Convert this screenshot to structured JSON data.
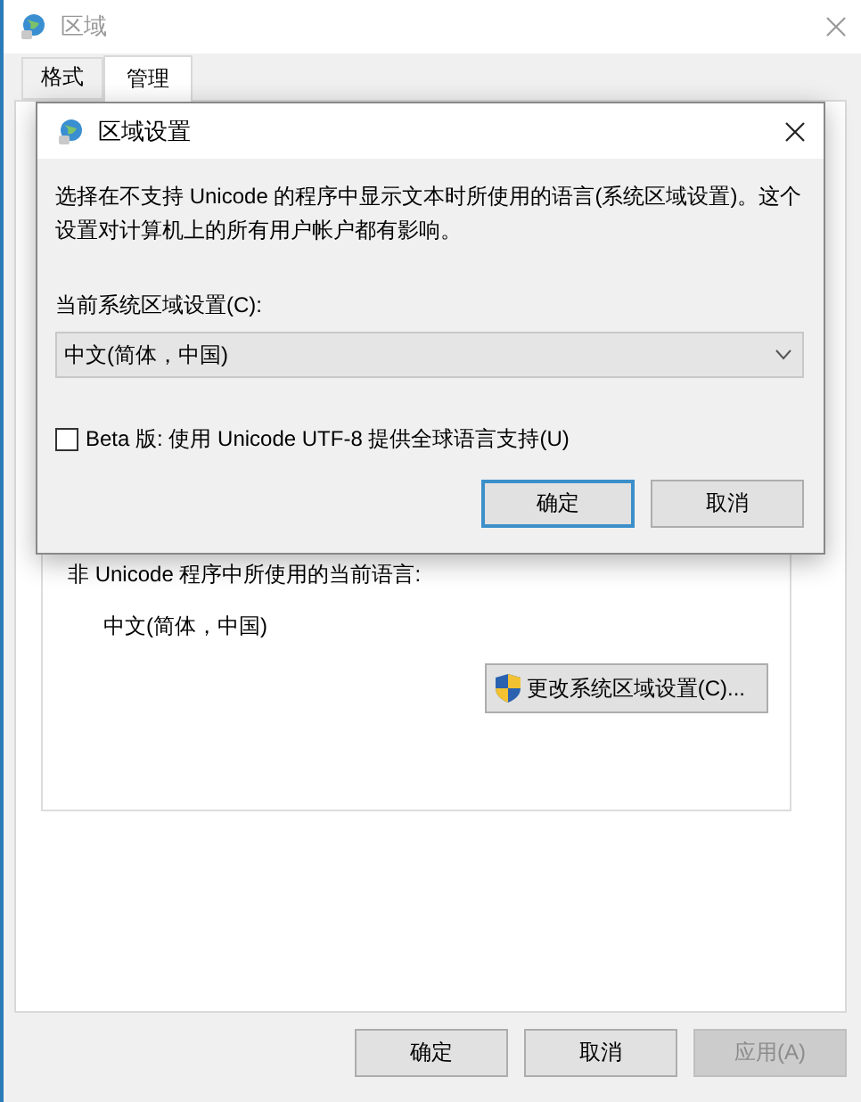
{
  "window": {
    "title": "区域"
  },
  "tabs": [
    {
      "label": "格式",
      "selected": false
    },
    {
      "label": "管理",
      "selected": true
    }
  ],
  "group": {
    "label": "非 Unicode 程序中所使用的当前语言:",
    "value": "中文(简体，中国)",
    "button": "更改系统区域设置(C)..."
  },
  "buttons": [
    {
      "label": "确定",
      "disabled": false
    },
    {
      "label": "取消",
      "disabled": false
    },
    {
      "label": "应用(A)",
      "disabled": true
    }
  ],
  "dialog": {
    "title": "区域设置",
    "description": "选择在不支持 Unicode 的程序中显示文本时所使用的语言(系统区域设置)。这个设置对计算机上的所有用户帐户都有影响。",
    "locale_label": "当前系统区域设置(C):",
    "locale_value": "中文(简体，中国)",
    "beta": {
      "label": "Beta 版: 使用 Unicode UTF-8 提供全球语言支持(U)",
      "checked": false
    },
    "buttons": [
      {
        "label": "确定",
        "focused": true
      },
      {
        "label": "取消",
        "focused": false
      }
    ]
  }
}
